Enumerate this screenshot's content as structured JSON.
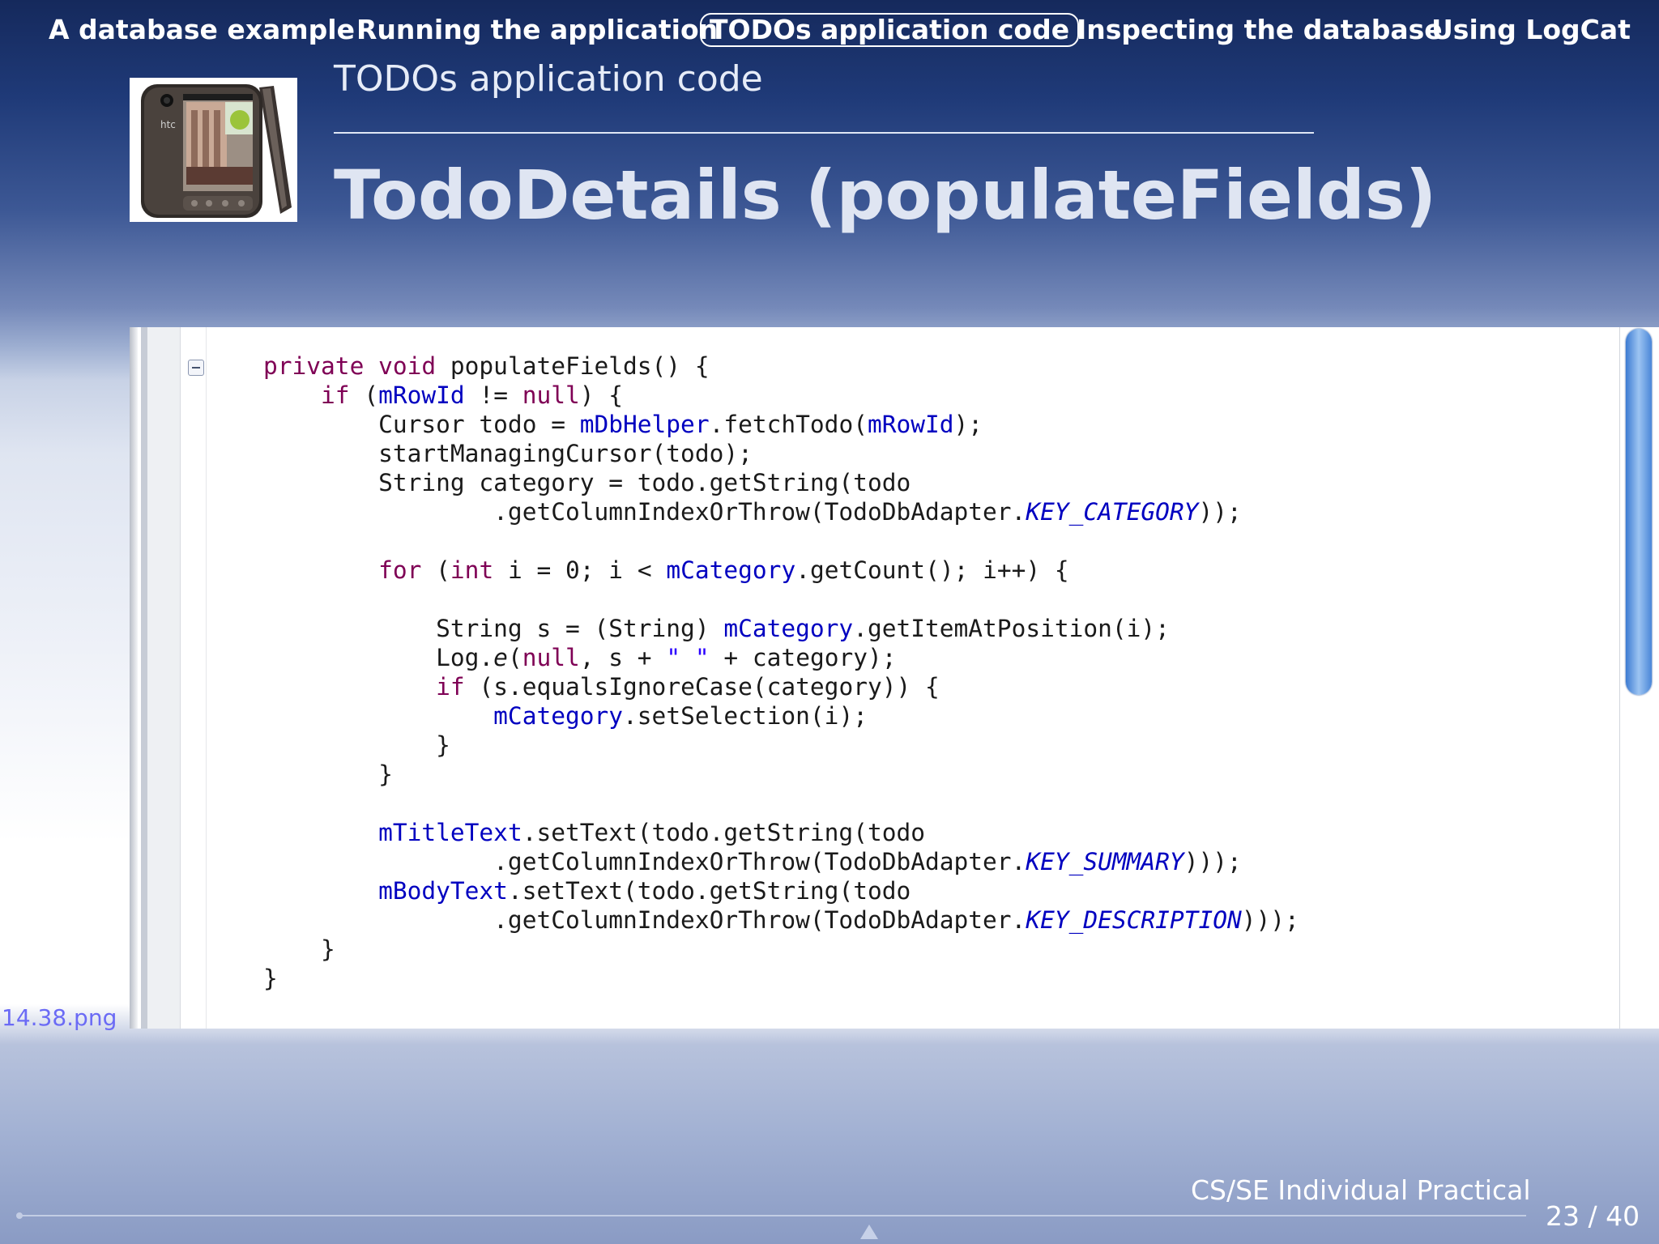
{
  "nav": {
    "items": [
      {
        "label": "A database example"
      },
      {
        "label": "Running the application"
      },
      {
        "label": "TODOs application code"
      },
      {
        "label": "Inspecting the database"
      },
      {
        "label": "Using LogCat"
      }
    ]
  },
  "header": {
    "section": "TODOs application code",
    "title": "TodoDetails (populateFields)"
  },
  "code": {
    "lines": [
      "private void populateFields() {",
      "    if (mRowId != null) {",
      "        Cursor todo = mDbHelper.fetchTodo(mRowId);",
      "        startManagingCursor(todo);",
      "        String category = todo.getString(todo",
      "                .getColumnIndexOrThrow(TodoDbAdapter.KEY_CATEGORY));",
      "",
      "        for (int i = 0; i < mCategory.getCount(); i++) {",
      "",
      "            String s = (String) mCategory.getItemAtPosition(i);",
      "            Log.e(null, s + \" \" + category);",
      "            if (s.equalsIgnoreCase(category)) {",
      "                mCategory.setSelection(i);",
      "            }",
      "        }",
      "",
      "        mTitleText.setText(todo.getString(todo",
      "                .getColumnIndexOrThrow(TodoDbAdapter.KEY_SUMMARY)));",
      "        mBodyText.setText(todo.getString(todo",
      "                .getColumnIndexOrThrow(TodoDbAdapter.KEY_DESCRIPTION)));",
      "    }",
      "}"
    ]
  },
  "image_caption": "14.38.png",
  "footer": {
    "course": "CS/SE Individual Practical",
    "page": "23 / 40"
  },
  "colors": {
    "keyword": "#7f0055",
    "field": "#0000c0",
    "string": "#2a00ff",
    "caption": "#6b6bf5"
  },
  "icons": {
    "logo": "htc-phone-image",
    "fold": "collapse-fold-icon",
    "nav_up": "navigation-up-arrow-icon"
  }
}
